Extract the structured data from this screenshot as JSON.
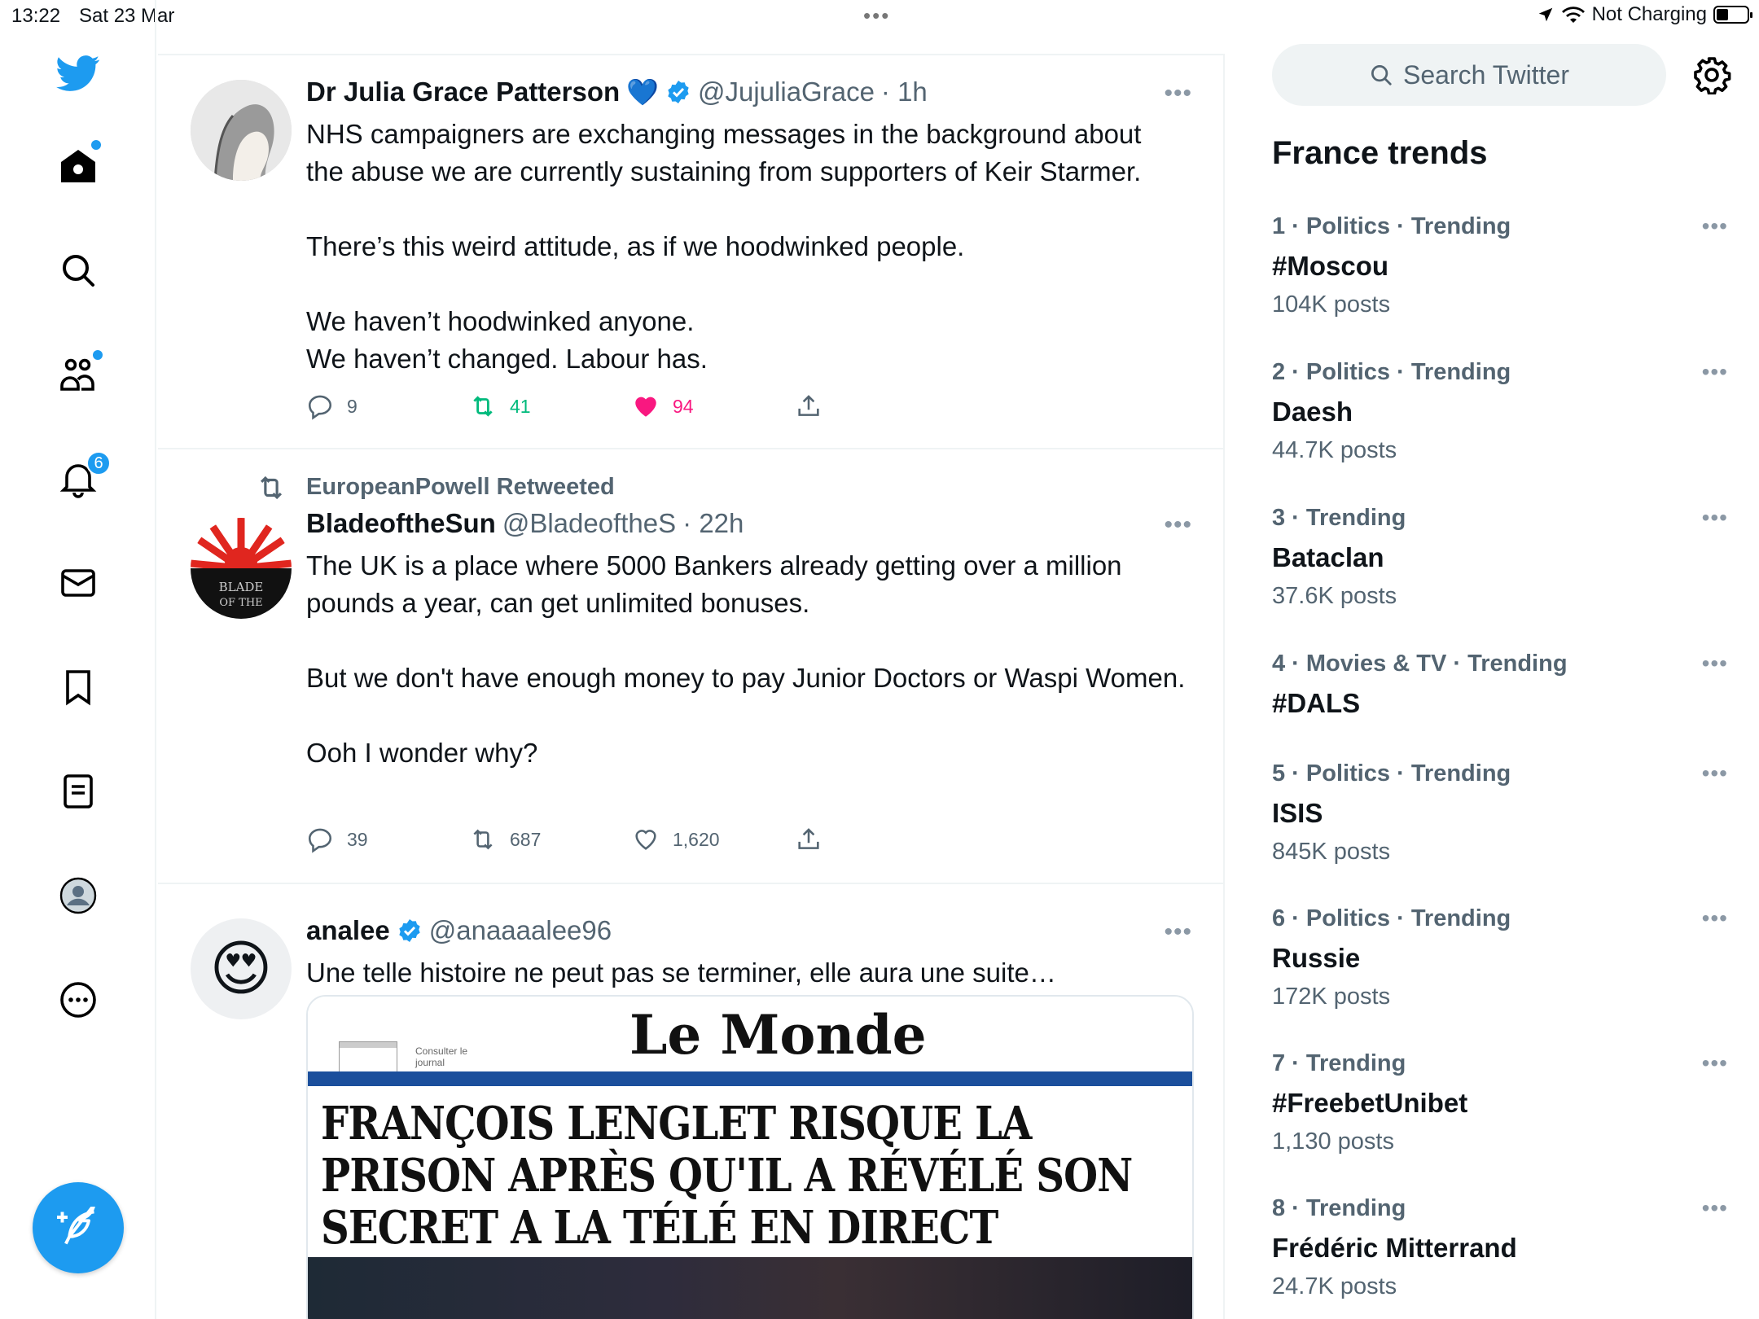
{
  "status_bar": {
    "time": "13:22",
    "date": "Sat 23 Mar",
    "multitask_dots": "•••",
    "battery_text": "Not Charging"
  },
  "nav": {
    "notifications_badge": "6",
    "accent_color": "#1d9bf0"
  },
  "tweets": [
    {
      "name": "Dr Julia Grace Patterson",
      "emoji": "💙",
      "handle": "@JujuliaGrace",
      "time": "· 1h",
      "text": "NHS campaigners are exchanging messages in the background about the abuse we are currently sustaining from supporters of Keir Starmer.\n\nThere’s this weird attitude, as if we hoodwinked people.\n\nWe haven’t hoodwinked anyone.\nWe haven’t changed. Labour has.",
      "replies": "9",
      "retweets": "41",
      "likes": "94"
    },
    {
      "retweeted_by": "EuropeanPowell Retweeted",
      "name": "BladeoftheSun",
      "handle": "@BladeoftheS",
      "time": "· 22h",
      "avatar_text": "BLADE OF THE",
      "text": "The UK is a place where 5000 Bankers already getting over a million pounds a year, can get unlimited bonuses.\n\nBut we don't have enough money to pay Junior Doctors or Waspi Women.\n\nOoh I wonder why?",
      "replies": "39",
      "retweets": "687",
      "likes": "1,620"
    },
    {
      "name": "analee",
      "handle": "@anaaaalee96",
      "text": "Une telle histoire ne peut pas se terminer, elle aura une suite…",
      "avatar_emoji": "😍",
      "media": {
        "masthead": "Le Monde",
        "consult": "Consulter le journal",
        "headline": "FRANÇOIS LENGLET RISQUE LA PRISON APRÈS QU'IL A RÉVÉLÉ SON SECRET A LA TÉLÉ EN DIRECT"
      }
    }
  ],
  "sidebar": {
    "search_placeholder": "Search Twitter",
    "trends_title": "France trends",
    "trends": [
      {
        "meta": "1 · Politics · Trending",
        "name": "#Moscou",
        "count": "104K posts"
      },
      {
        "meta": "2 · Politics · Trending",
        "name": "Daesh",
        "count": "44.7K posts"
      },
      {
        "meta": "3 · Trending",
        "name": "Bataclan",
        "count": "37.6K posts"
      },
      {
        "meta": "4 · Movies & TV · Trending",
        "name": "#DALS",
        "count": ""
      },
      {
        "meta": "5 · Politics · Trending",
        "name": "ISIS",
        "count": "845K posts"
      },
      {
        "meta": "6 · Politics · Trending",
        "name": "Russie",
        "count": "172K posts"
      },
      {
        "meta": "7 · Trending",
        "name": "#FreebetUnibet",
        "count": "1,130 posts"
      },
      {
        "meta": "8 · Trending",
        "name": "Frédéric Mitterrand",
        "count": "24.7K posts"
      }
    ]
  }
}
